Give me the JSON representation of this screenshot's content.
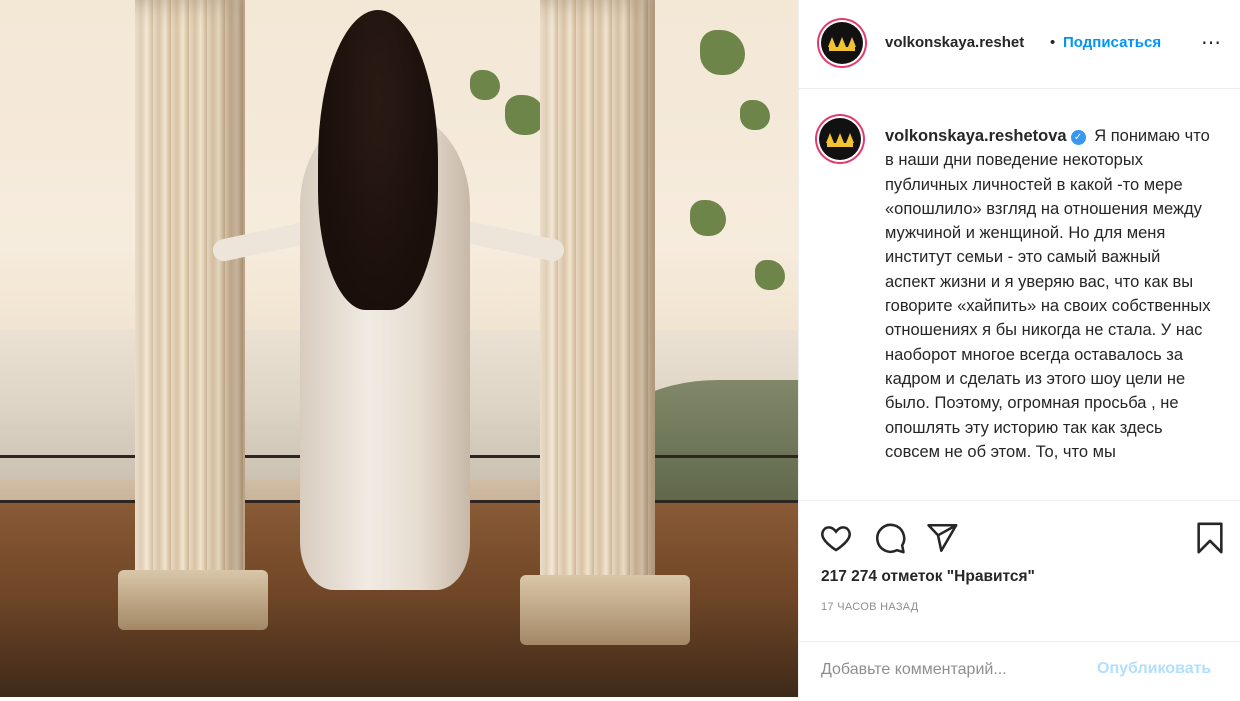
{
  "post": {
    "username": "volkonskaya.reshet",
    "dot": "•",
    "follow_label": "Подписаться",
    "more_icon": "⋯"
  },
  "caption": {
    "username": "volkonskaya.reshetova",
    "verified": "✓",
    "text": "Я понимаю что в наши дни поведение некоторых публичных личностей в какой -то мере «опошлило» взгляд на отношения между мужчиной и женщиной. Но для меня институт семьи - это самый важный аспект жизни и я уверяю вас, что как вы говорите «хайпить» на своих собственных отношениях я бы никогда не стала. У нас наоборот многое всегда оставалось за кадром и сделать из этого шоу цели не было. Поэтому, огромная просьба , не опошлять эту историю так как здесь совсем не об этом. То, что мы"
  },
  "stats": {
    "likes": "217 274 отметок \"Нравится\"",
    "time": "17 ЧАСОВ НАЗАД"
  },
  "comment": {
    "placeholder": "Добавьте комментарий...",
    "publish_label": "Опубликовать"
  },
  "icons": {
    "like": "heart-icon",
    "comment": "comment-icon",
    "share": "paper-plane-icon",
    "save": "bookmark-icon"
  },
  "colors": {
    "accent": "#0095f6",
    "publish_disabled": "#b2dffc",
    "verified": "#3897f0",
    "avatar_ring": "#e13b6e",
    "crown": "#f1c232"
  }
}
